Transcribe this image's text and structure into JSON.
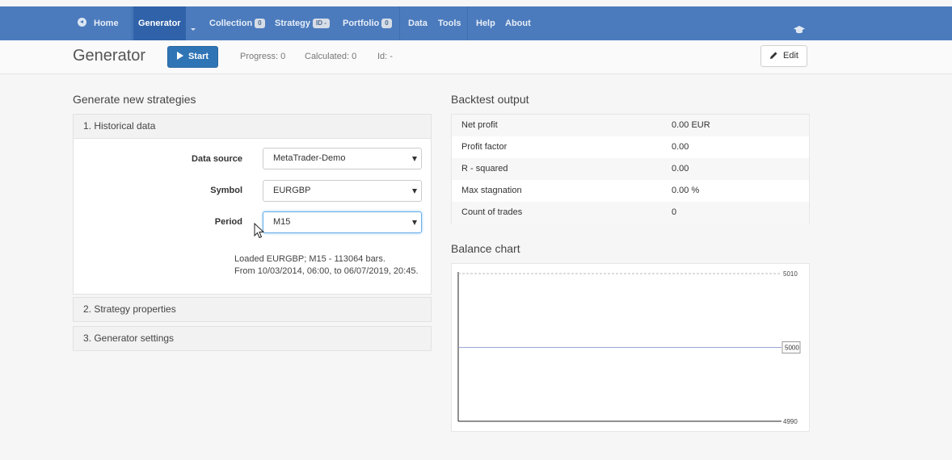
{
  "nav": {
    "home": "Home",
    "generator": "Generator",
    "collection": "Collection",
    "collection_badge": "0",
    "strategy": "Strategy",
    "strategy_badge": "ID -",
    "portfolio": "Portfolio",
    "portfolio_badge": "0",
    "data": "Data",
    "tools": "Tools",
    "help": "Help",
    "about": "About"
  },
  "toolbar": {
    "title": "Generator",
    "start_label": "Start",
    "progress": "Progress: 0",
    "calculated": "Calculated: 0",
    "id": "Id: -",
    "edit_label": "Edit"
  },
  "generate": {
    "title": "Generate new strategies",
    "section1": "1. Historical data",
    "section2": "2. Strategy properties",
    "section3": "3. Generator settings",
    "data_source_label": "Data source",
    "data_source_value": "MetaTrader-Demo",
    "symbol_label": "Symbol",
    "symbol_value": "EURGBP",
    "period_label": "Period",
    "period_value": "M15",
    "info_line1": "Loaded EURGBP; M15 - 113064 bars.",
    "info_line2": "From 10/03/2014, 06:00, to 06/07/2019, 20:45."
  },
  "backtest": {
    "title": "Backtest output",
    "rows": [
      {
        "label": "Net profit",
        "value": "0.00 EUR"
      },
      {
        "label": "Profit factor",
        "value": "0.00"
      },
      {
        "label": "R - squared",
        "value": "0.00"
      },
      {
        "label": "Max stagnation",
        "value": "0.00 %"
      },
      {
        "label": "Count of trades",
        "value": "0"
      }
    ]
  },
  "balance": {
    "title": "Balance chart"
  },
  "chart_data": {
    "type": "line",
    "title": "",
    "xlabel": "",
    "ylabel": "",
    "ylim": [
      4990,
      5010
    ],
    "y_ticks": [
      5010,
      4990
    ],
    "current_value": 5000,
    "series": [
      {
        "values": [
          5000,
          5000
        ]
      }
    ]
  },
  "colors": {
    "navbar": "#4b7bbd",
    "nav_active": "#2f62a8",
    "primary_button": "#2f75b5",
    "balance_line": "#9aa6d6"
  }
}
